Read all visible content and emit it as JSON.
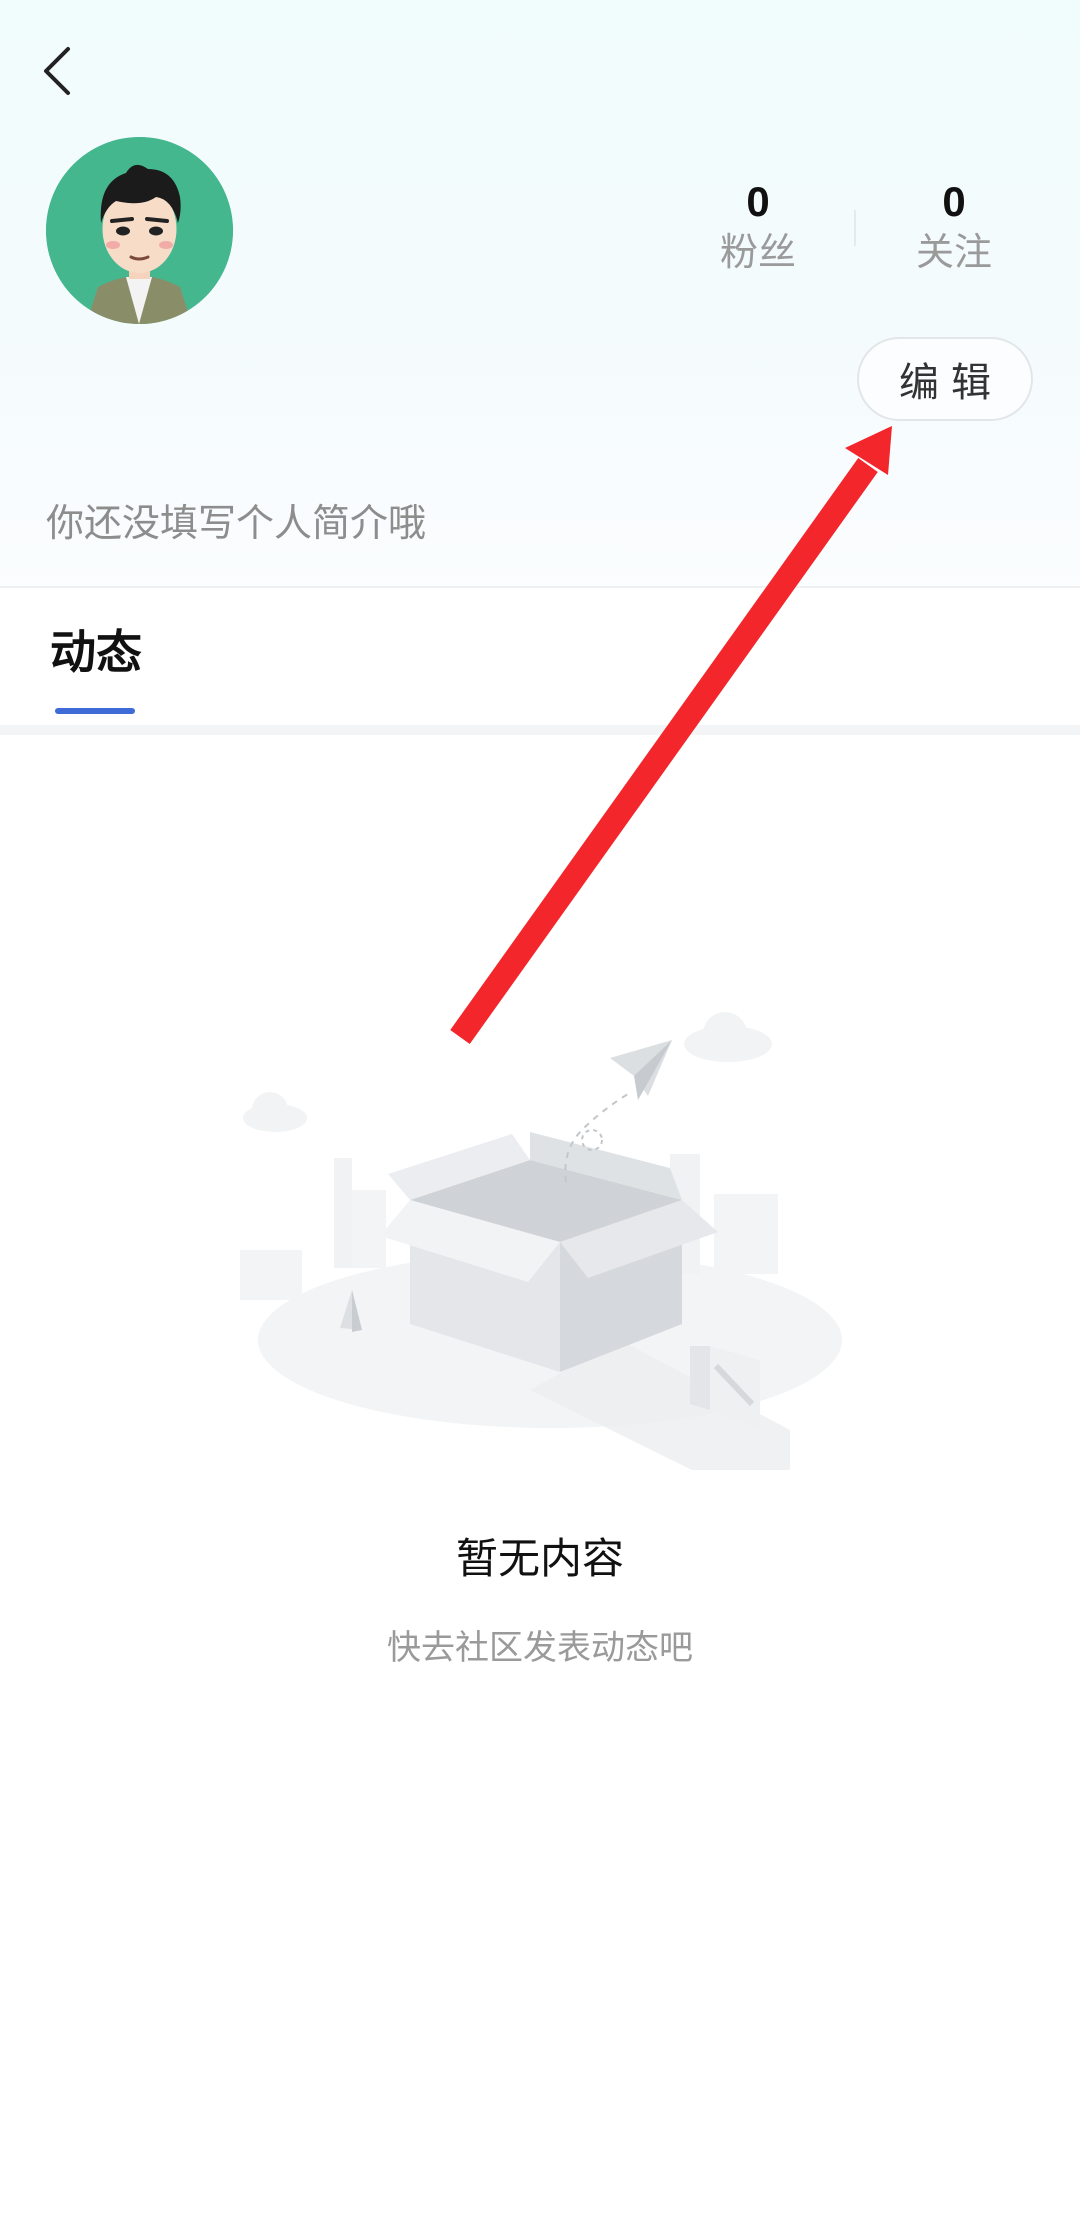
{
  "profile": {
    "username": "",
    "bio": "你还没填写个人简介哦",
    "edit_label": "编辑"
  },
  "stats": [
    {
      "value": "0",
      "label": "粉丝"
    },
    {
      "value": "0",
      "label": "关注"
    }
  ],
  "tabs": [
    {
      "label": "动态",
      "active": true
    }
  ],
  "empty_state": {
    "title": "暂无内容",
    "subtitle": "快去社区发表动态吧"
  },
  "colors": {
    "accent": "#3f6bd8",
    "avatar_bg": "#45b78f",
    "annotation_arrow": "#f2262b"
  },
  "icons": {
    "back": "chevron-left-icon"
  }
}
